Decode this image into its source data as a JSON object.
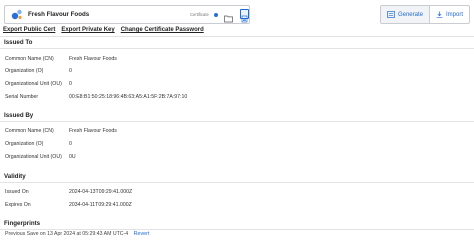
{
  "certificate": {
    "name": "Fresh Flavour Foods",
    "type_label": "Certificate",
    "accent": "#1f6bd6"
  },
  "toolbar": {
    "generate_label": "Generate",
    "import_label": "Import"
  },
  "tabs": [
    {
      "label": "Export Public Cert"
    },
    {
      "label": "Export Private Key"
    },
    {
      "label": "Change Certificate Password"
    }
  ],
  "issued_to": {
    "title": "Issued To",
    "rows": [
      {
        "label": "Common Name (CN)",
        "value": "Fresh Flavour Foods"
      },
      {
        "label": "Organization (O)",
        "value": "0"
      },
      {
        "label": "Organizational Unit (OU)",
        "value": "0"
      },
      {
        "label": "Serial Number",
        "value": "00:E8:B1:50:25:18:96:4B:63:A5:A1:5F:2B:7A:97:10"
      }
    ]
  },
  "issued_by": {
    "title": "Issued By",
    "rows": [
      {
        "label": "Common Name (CN)",
        "value": "Fresh Flavour Foods"
      },
      {
        "label": "Organization (O)",
        "value": "0"
      },
      {
        "label": "Organizational Unit (OU)",
        "value": "0U"
      }
    ]
  },
  "validity": {
    "title": "Validity",
    "rows": [
      {
        "label": "Issued On",
        "value": "2024-04-13T09:29:41.000Z"
      },
      {
        "label": "Expires On",
        "value": "2034-04-11T09:29:41.000Z"
      }
    ]
  },
  "fingerprints": {
    "title": "Fingerprints"
  },
  "footer": {
    "saved_text": "Previous Save on 13 Apr 2024 at 05:29:43 AM UTC-4",
    "revert_label": "Revert"
  }
}
